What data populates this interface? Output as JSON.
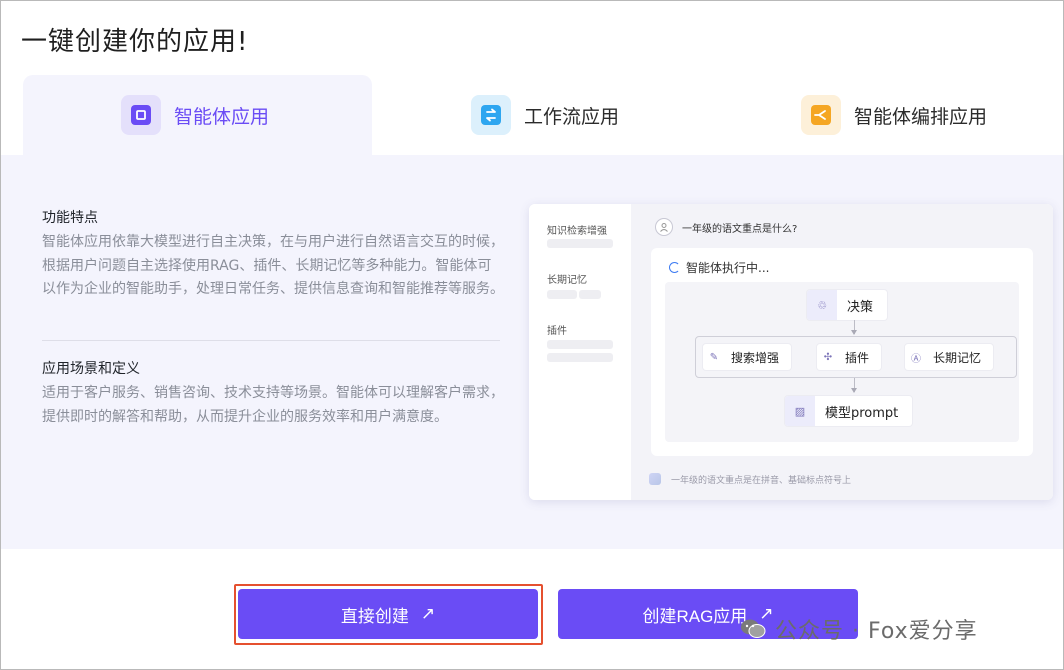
{
  "title": "一键创建你的应用!",
  "tabs": [
    {
      "label": "智能体应用",
      "icon": "agent-app-icon",
      "color": "#6a4cf5",
      "active": true
    },
    {
      "label": "工作流应用",
      "icon": "workflow-icon",
      "color": "#2ea6f0",
      "active": false
    },
    {
      "label": "智能体编排应用",
      "icon": "agent-orchestration-icon",
      "color": "#f5a623",
      "active": false
    }
  ],
  "features": {
    "title": "功能特点",
    "desc": "智能体应用依靠大模型进行自主决策，在与用户进行自然语言交互的时候，根据用户问题自主选择使用RAG、插件、长期记忆等多种能力。智能体可以作为企业的智能助手，处理日常任务、提供信息查询和智能推荐等服务。"
  },
  "scenarios": {
    "title": "应用场景和定义",
    "desc": "适用于客户服务、销售咨询、技术支持等场景。智能体可以理解客户需求，提供即时的解答和帮助，从而提升企业的服务效率和用户满意度。"
  },
  "preview": {
    "side_labels": [
      "知识检索增强",
      "长期记忆",
      "插件"
    ],
    "question": "一年级的语文重点是什么?",
    "status": "智能体执行中...",
    "nodes": {
      "decision": "决策",
      "search": "搜索增强",
      "plugin": "插件",
      "memory": "长期记忆",
      "model": "模型prompt"
    },
    "input_text": "一年级的语文重点是在拼音、基础标点符号上"
  },
  "buttons": {
    "direct": "直接创建",
    "rag": "创建RAG应用"
  },
  "watermark": "公众号 · Fox爱分享",
  "colors": {
    "accent": "#6a4cf5",
    "highlight": "#e5502f",
    "panel_bg": "#f4f4fd"
  }
}
